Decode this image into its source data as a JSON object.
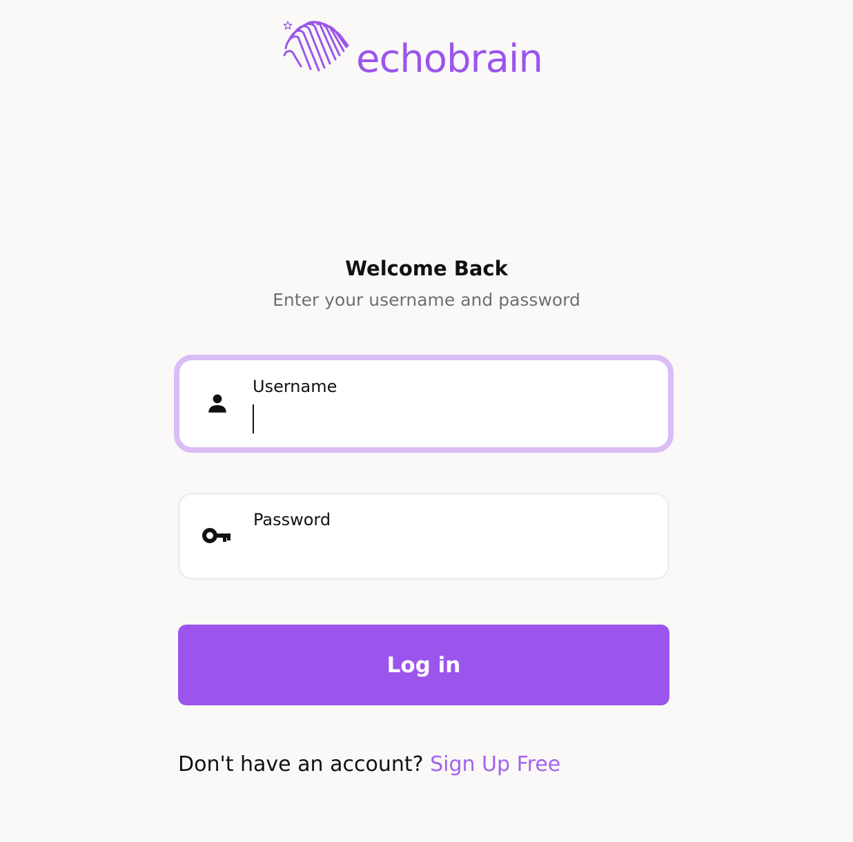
{
  "brand": {
    "name": "echobrain",
    "color": "#9b55ec",
    "logo_icon": "wave-brain-icon"
  },
  "header": {
    "title": "Welcome Back",
    "subtitle": "Enter your username and password"
  },
  "form": {
    "username": {
      "label": "Username",
      "value": "",
      "icon": "person-icon",
      "focused": true
    },
    "password": {
      "label": "Password",
      "value": "",
      "icon": "key-icon"
    },
    "submit_label": "Log in"
  },
  "footer": {
    "prompt": "Don't have an account?",
    "signup_label": "Sign Up Free"
  },
  "colors": {
    "background": "#faf9f7",
    "accent": "#9b55ec",
    "focus_ring": "#d9bdf5",
    "muted_text": "#6f6f6f"
  }
}
